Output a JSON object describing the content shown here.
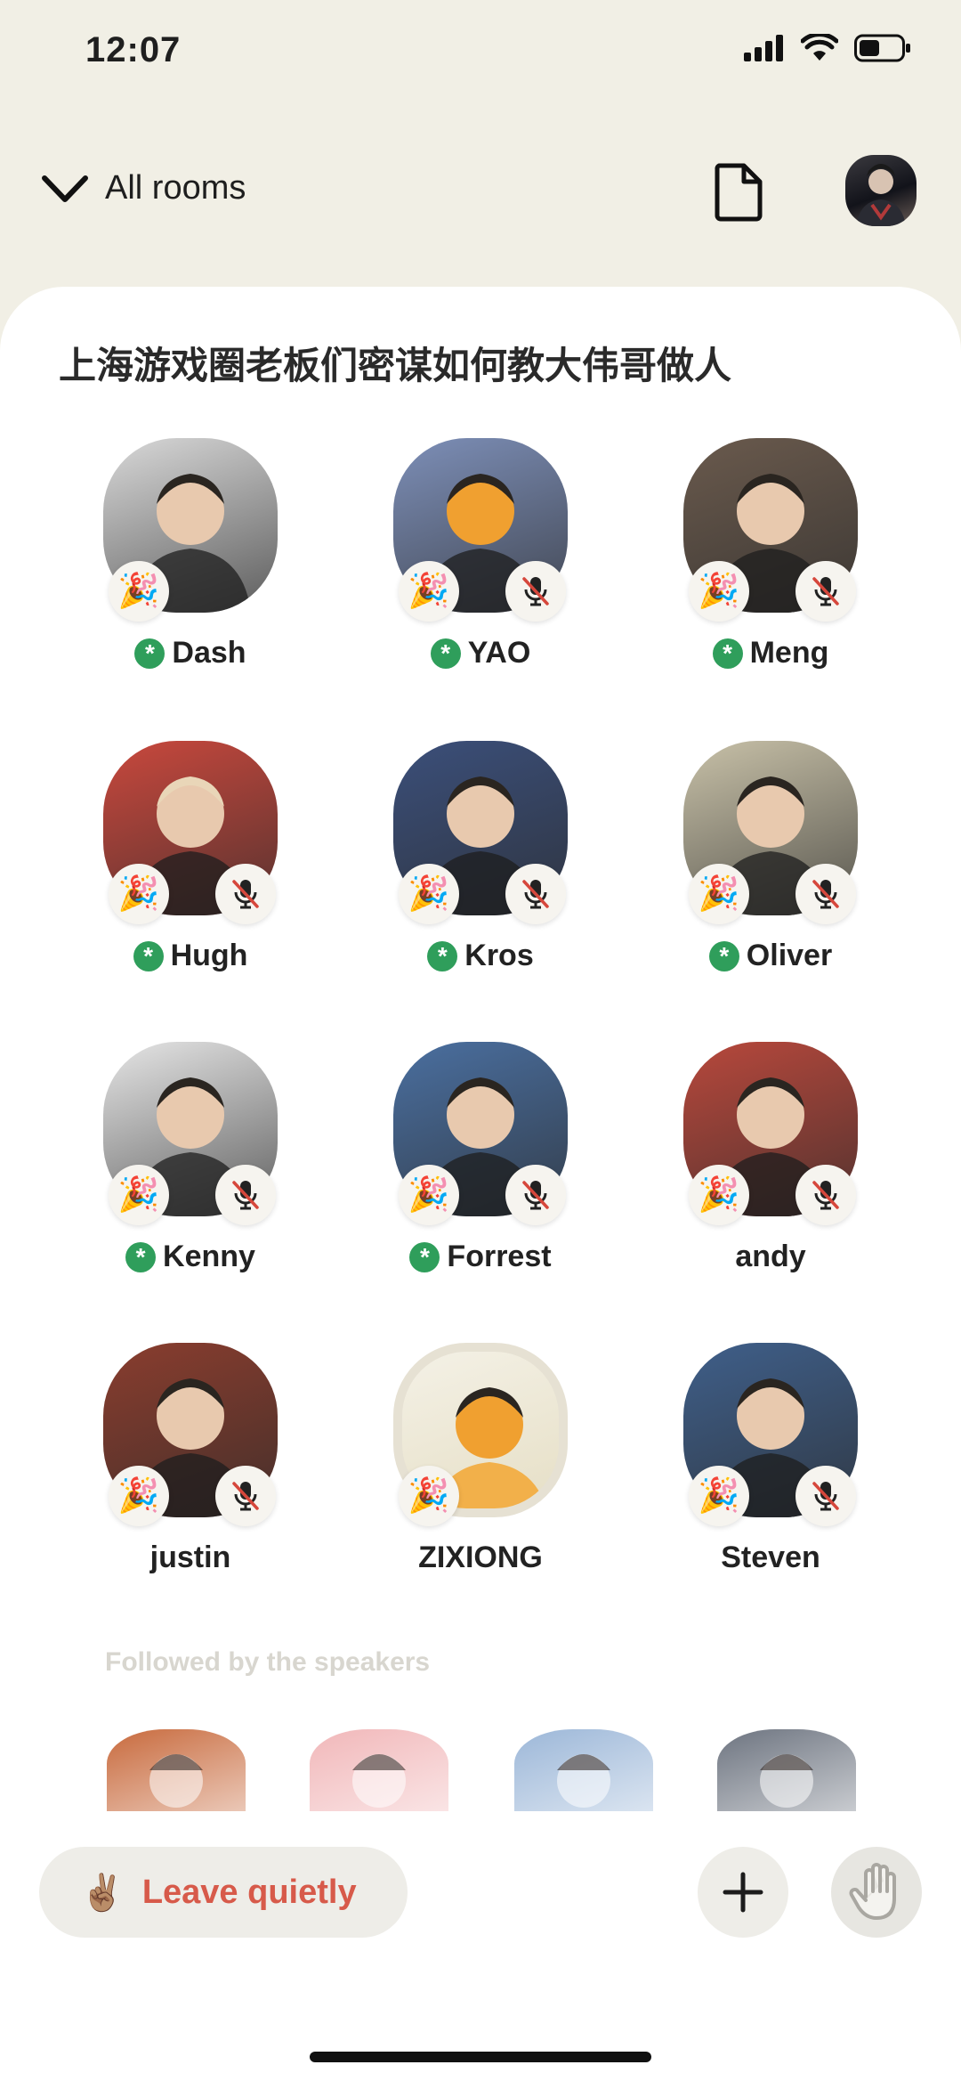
{
  "status_bar": {
    "time": "12:07"
  },
  "nav": {
    "all_rooms_label": "All rooms"
  },
  "room": {
    "title": "上海游戏圈老板们密谋如何教大伟哥做人"
  },
  "speakers": [
    {
      "name": "Dash",
      "moderator": true,
      "muted": false,
      "avatar_icon": "person-photo",
      "bg": "#d9d9d9"
    },
    {
      "name": "YAO",
      "moderator": true,
      "muted": true,
      "avatar_icon": "cartoon-dog",
      "bg": "#7d8fb8"
    },
    {
      "name": "Meng",
      "moderator": true,
      "muted": true,
      "avatar_icon": "child-headphones",
      "bg": "#6a5a4d"
    },
    {
      "name": "Hugh",
      "moderator": true,
      "muted": true,
      "avatar_icon": "anime-girl",
      "bg": "#c9483d"
    },
    {
      "name": "Kros",
      "moderator": true,
      "muted": true,
      "avatar_icon": "cartoon-mask",
      "bg": "#3b4f7a"
    },
    {
      "name": "Oliver",
      "moderator": true,
      "muted": true,
      "avatar_icon": "person-photo",
      "bg": "#c8c1a8"
    },
    {
      "name": "Kenny",
      "moderator": true,
      "muted": true,
      "avatar_icon": "person-photo",
      "bg": "#e6e6e6"
    },
    {
      "name": "Forrest",
      "moderator": true,
      "muted": true,
      "avatar_icon": "anime-art",
      "bg": "#4a6fa0"
    },
    {
      "name": "andy",
      "moderator": false,
      "muted": true,
      "avatar_icon": "person-event",
      "bg": "#b8483c"
    },
    {
      "name": "justin",
      "moderator": false,
      "muted": true,
      "avatar_icon": "person-party",
      "bg": "#8a3d2e"
    },
    {
      "name": "ZIXIONG",
      "moderator": false,
      "muted": false,
      "avatar_icon": "corgi-cartoon",
      "bg": "#e8e4d6"
    },
    {
      "name": "Steven",
      "moderator": false,
      "muted": true,
      "avatar_icon": "yacht-photo",
      "bg": "#3f5f8a"
    }
  ],
  "followed_section": {
    "label": "Followed by the speakers"
  },
  "listeners": [
    {
      "avatar_icon": "cartoon-face",
      "bg": "#c86a3d"
    },
    {
      "avatar_icon": "pink-animal",
      "bg": "#f1b7b9"
    },
    {
      "avatar_icon": "person-photo",
      "bg": "#9cb7d8"
    },
    {
      "avatar_icon": "person-gray",
      "bg": "#6d7480"
    }
  ],
  "controls": {
    "leave_emoji": "✌🏽",
    "leave_label": "Leave quietly",
    "party_emoji": "🎉"
  },
  "colors": {
    "background": "#f1efe5",
    "card": "#ffffff",
    "leave_text": "#d75a4a",
    "moderator_badge": "#2f9e5b"
  }
}
